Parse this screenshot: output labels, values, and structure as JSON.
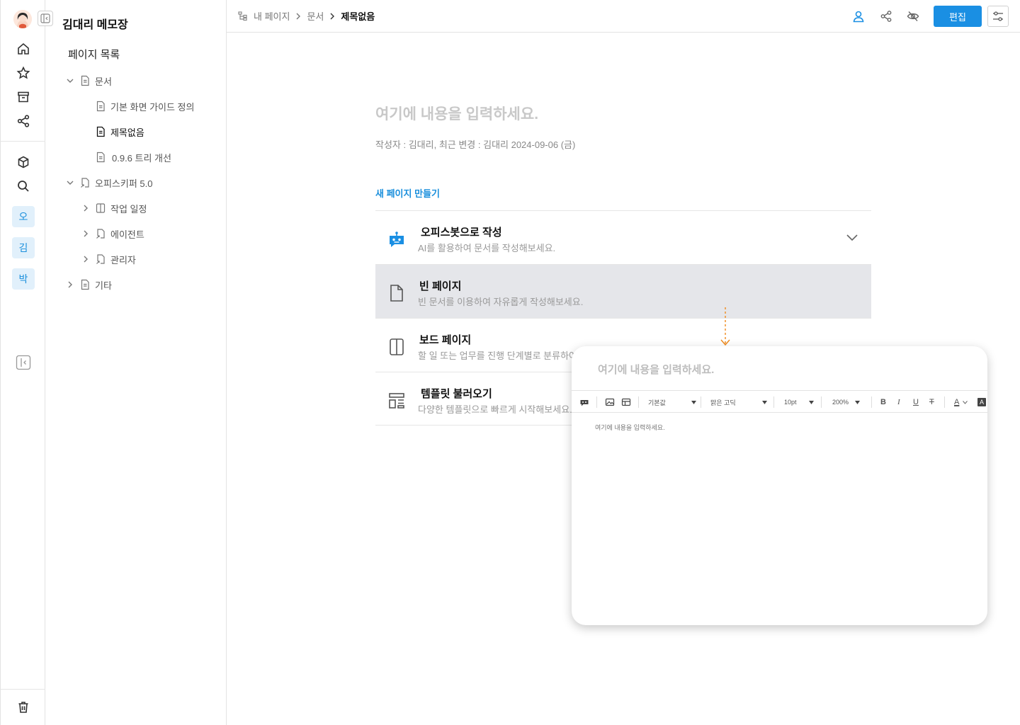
{
  "sidebar": {
    "notebook_title": "김대리 메모장",
    "pagelist_title": "페이지 목록",
    "tree": [
      {
        "label": "문서",
        "level": 0,
        "expanded": true,
        "icon": "document-icon"
      },
      {
        "label": "기본 화면 가이드 정의",
        "level": 1,
        "icon": "document-icon"
      },
      {
        "label": "제목없음",
        "level": 1,
        "icon": "document-icon",
        "active": true
      },
      {
        "label": "0.9.6 트리 개선",
        "level": 1,
        "icon": "document-icon"
      },
      {
        "label": "오피스키퍼 5.0",
        "level": 0,
        "expanded": true,
        "icon": "linked-page-icon"
      },
      {
        "label": "작업 일정",
        "level": 1,
        "collapsed": true,
        "icon": "board-icon"
      },
      {
        "label": "에이전트",
        "level": 1,
        "collapsed": true,
        "icon": "linked-page-icon"
      },
      {
        "label": "관리자",
        "level": 1,
        "collapsed": true,
        "icon": "linked-page-icon"
      },
      {
        "label": "기타",
        "level": 0,
        "collapsed": true,
        "icon": "document-icon"
      }
    ]
  },
  "rail": {
    "spaces": [
      "오",
      "김",
      "박"
    ],
    "icons": [
      "home-icon",
      "star-icon",
      "archive-icon",
      "share-icon",
      "cube-icon",
      "search-icon",
      "collapse-panel-icon",
      "trash-icon"
    ]
  },
  "topbar": {
    "breadcrumb": [
      "내 페이지",
      "문서",
      "제목없음"
    ],
    "edit_label": "편집"
  },
  "main": {
    "title_placeholder": "여기에 내용을 입력하세요.",
    "meta": "작성자 : 김대리,  최근 변경 : 김대리  2024-09-06 (금)",
    "new_page_label": "새 페이지 만들기",
    "options": [
      {
        "title": "오피스봇으로 작성",
        "desc": "AI를 활용하여 문서를 작성해보세요.",
        "icon": "bot-icon"
      },
      {
        "title": "빈 페이지",
        "desc": "빈 문서를 이용하여 자유롭게 작성해보세요.",
        "icon": "blank-page-icon",
        "selected": true
      },
      {
        "title": "보드 페이지",
        "desc": "할 일 또는 업무를 진행 단계별로 분류하여",
        "icon": "board-icon"
      },
      {
        "title": "템플릿 불러오기",
        "desc": "다양한 템플릿으로 빠르게 시작해보세요.",
        "icon": "template-icon"
      }
    ]
  },
  "popup": {
    "title_placeholder": "여기에 내용을 입력하세요.",
    "toolbar": {
      "style": "기본값",
      "font": "맑은 고딕",
      "size": "10pt",
      "zoom": "200%",
      "bold": "B",
      "italic": "I",
      "underline": "U",
      "strike": "T",
      "font_color": "A",
      "bg_color": "A"
    },
    "body_placeholder": "여기에 내용을 입력하세요."
  },
  "colors": {
    "accent": "#1a8fe3",
    "arrow": "#f08a1c",
    "selected_row": "#e5e6ea"
  }
}
